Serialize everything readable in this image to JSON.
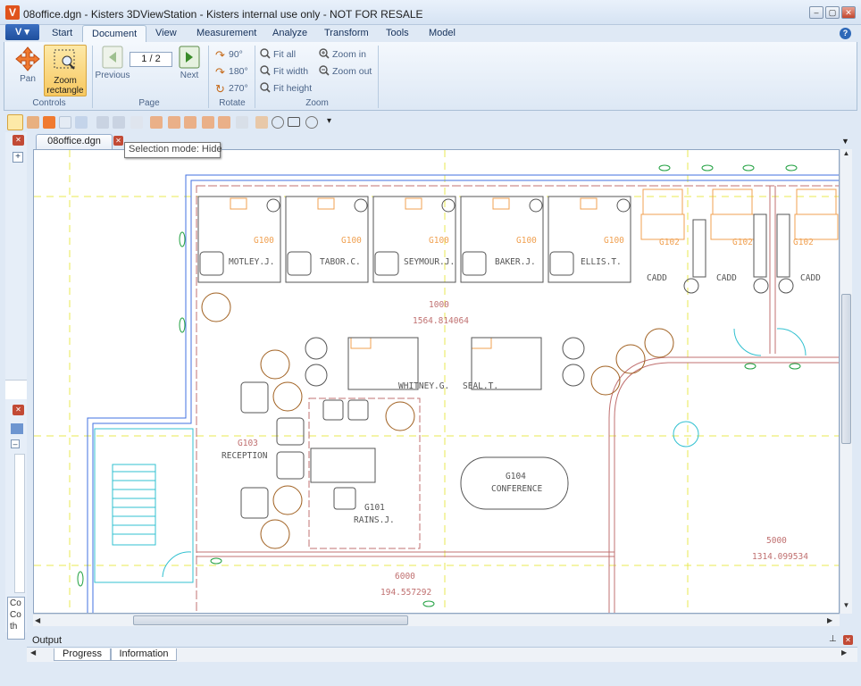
{
  "window": {
    "title": "08office.dgn - Kisters 3DViewStation - Kisters internal use only - NOT FOR RESALE",
    "logo": "V"
  },
  "app_menu": "V",
  "tabs": [
    "Start",
    "Document",
    "View",
    "Measurement",
    "Analyze",
    "Transform",
    "Tools",
    "Model"
  ],
  "active_tab": "Document",
  "ribbon": {
    "controls": {
      "label": "Controls",
      "pan": "Pan",
      "zoom_rect": "Zoom rectangle"
    },
    "page": {
      "label": "Page",
      "value": "1 / 2",
      "previous": "Previous",
      "next": "Next"
    },
    "rotate": {
      "label": "Rotate",
      "r90": "90°",
      "r180": "180°",
      "r270": "270°"
    },
    "zoom": {
      "label": "Zoom",
      "fit_all": "Fit all",
      "fit_width": "Fit width",
      "fit_height": "Fit height",
      "zoom_in": "Zoom in",
      "zoom_out": "Zoom out"
    }
  },
  "document_tab": "08office.dgn",
  "tooltip": "Selection mode: Hide",
  "drawing": {
    "rooms": [
      {
        "code": "G100",
        "name": "MOTLEY.J."
      },
      {
        "code": "G100",
        "name": "TABOR.C."
      },
      {
        "code": "G100",
        "name": "SEYMOUR.J."
      },
      {
        "code": "G100",
        "name": "BAKER.J."
      },
      {
        "code": "G100",
        "name": "ELLIS.T."
      }
    ],
    "cadd_codes": [
      "G102",
      "G102",
      "G102"
    ],
    "cadd_label": "CADD",
    "area1": {
      "id": "1000",
      "value": "1564.814064"
    },
    "names_mid": [
      "WHITNEY.G.",
      "SEAL.T."
    ],
    "reception": {
      "code": "G103",
      "name": "RECEPTION"
    },
    "conference": {
      "code": "G104",
      "name": "CONFERENCE"
    },
    "rains": {
      "code": "G101",
      "name": "RAINS.J."
    },
    "area5": {
      "id": "5000",
      "value": "1314.099534"
    },
    "area6": {
      "id": "6000",
      "value": "194.557292"
    }
  },
  "output": {
    "title": "Output",
    "tabs": [
      "Progress",
      "Information"
    ]
  },
  "colors": {
    "wall": "#c07070",
    "furniture": "#555555",
    "orange": "#f0a050",
    "yellow_dash": "#e8e850",
    "cyan": "#30c0d0",
    "blue": "#4070e0",
    "green": "#20a040",
    "tree": "#a06020"
  }
}
